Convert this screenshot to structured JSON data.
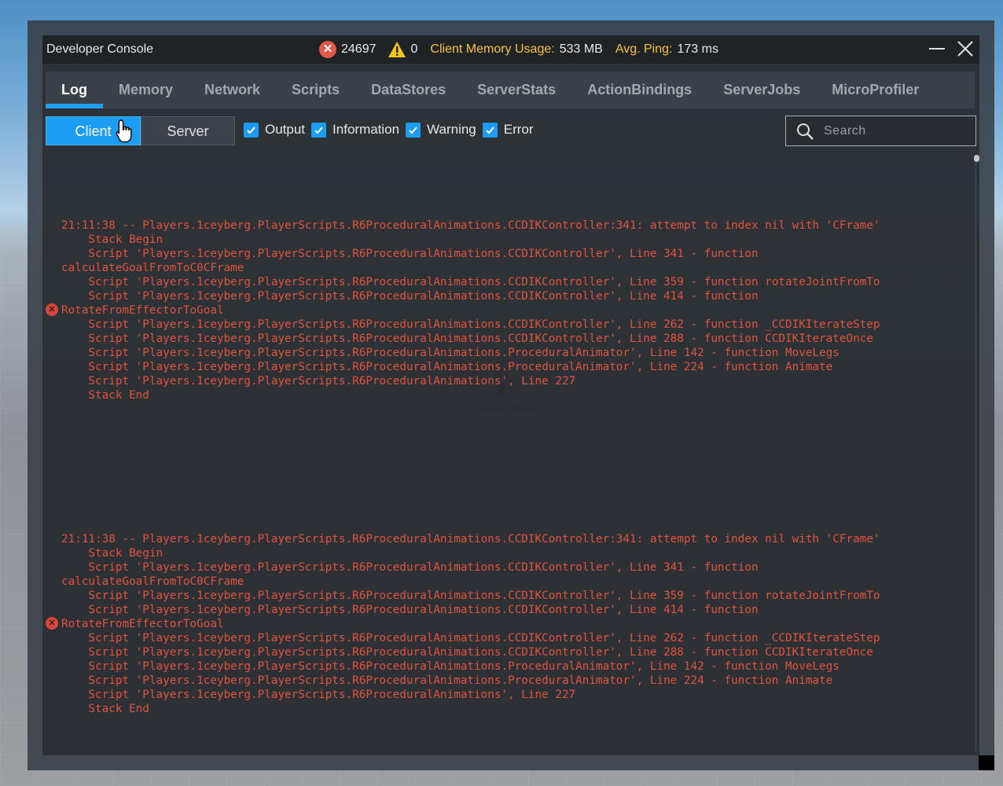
{
  "window": {
    "title": "Developer Console",
    "error_count": "24697",
    "warning_count": "0",
    "memory_label": "Client Memory Usage:",
    "memory_value": "533 MB",
    "ping_label": "Avg. Ping:",
    "ping_value": "173 ms"
  },
  "tabs": [
    {
      "label": "Log",
      "active": true
    },
    {
      "label": "Memory"
    },
    {
      "label": "Network"
    },
    {
      "label": "Scripts"
    },
    {
      "label": "DataStores"
    },
    {
      "label": "ServerStats"
    },
    {
      "label": "ActionBindings"
    },
    {
      "label": "ServerJobs"
    },
    {
      "label": "MicroProfiler"
    }
  ],
  "toolbar": {
    "client_label": "Client",
    "server_label": "Server",
    "filters": [
      {
        "label": "Output",
        "checked": true
      },
      {
        "label": "Information",
        "checked": true
      },
      {
        "label": "Warning",
        "checked": true
      },
      {
        "label": "Error",
        "checked": true
      }
    ],
    "search_placeholder": "Search"
  },
  "colors": {
    "accent": "#1c9cf2",
    "error_text": "#e0533f",
    "stat_label": "#f7c33c"
  },
  "log_entries": [
    {
      "lines": [
        "21:11:38 -- Players.1ceyberg.PlayerScripts.R6ProceduralAnimations.CCDIKController:341: attempt to index nil with 'CFrame'",
        "    Stack Begin",
        "    Script 'Players.1ceyberg.PlayerScripts.R6ProceduralAnimations.CCDIKController', Line 341 - function",
        "calculateGoalFromToC0CFrame",
        "    Script 'Players.1ceyberg.PlayerScripts.R6ProceduralAnimations.CCDIKController', Line 359 - function rotateJointFromTo",
        "    Script 'Players.1ceyberg.PlayerScripts.R6ProceduralAnimations.CCDIKController', Line 414 - function",
        "RotateFromEffectorToGoal",
        "    Script 'Players.1ceyberg.PlayerScripts.R6ProceduralAnimations.CCDIKController', Line 262 - function _CCDIKIterateStep",
        "    Script 'Players.1ceyberg.PlayerScripts.R6ProceduralAnimations.CCDIKController', Line 288 - function CCDIKIterateOnce",
        "    Script 'Players.1ceyberg.PlayerScripts.R6ProceduralAnimations.ProceduralAnimator', Line 142 - function MoveLegs",
        "    Script 'Players.1ceyberg.PlayerScripts.R6ProceduralAnimations.ProceduralAnimator', Line 224 - function Animate",
        "    Script 'Players.1ceyberg.PlayerScripts.R6ProceduralAnimations', Line 227",
        "    Stack End"
      ]
    },
    {
      "lines": [
        "21:11:38 -- Players.1ceyberg.PlayerScripts.R6ProceduralAnimations.CCDIKController:341: attempt to index nil with 'CFrame'",
        "    Stack Begin",
        "    Script 'Players.1ceyberg.PlayerScripts.R6ProceduralAnimations.CCDIKController', Line 341 - function",
        "calculateGoalFromToC0CFrame",
        "    Script 'Players.1ceyberg.PlayerScripts.R6ProceduralAnimations.CCDIKController', Line 359 - function rotateJointFromTo",
        "    Script 'Players.1ceyberg.PlayerScripts.R6ProceduralAnimations.CCDIKController', Line 414 - function",
        "RotateFromEffectorToGoal",
        "    Script 'Players.1ceyberg.PlayerScripts.R6ProceduralAnimations.CCDIKController', Line 262 - function _CCDIKIterateStep",
        "    Script 'Players.1ceyberg.PlayerScripts.R6ProceduralAnimations.CCDIKController', Line 288 - function CCDIKIterateOnce",
        "    Script 'Players.1ceyberg.PlayerScripts.R6ProceduralAnimations.ProceduralAnimator', Line 142 - function MoveLegs",
        "    Script 'Players.1ceyberg.PlayerScripts.R6ProceduralAnimations.ProceduralAnimator', Line 224 - function Animate",
        "    Script 'Players.1ceyberg.PlayerScripts.R6ProceduralAnimations', Line 227",
        "    Stack End"
      ]
    }
  ]
}
